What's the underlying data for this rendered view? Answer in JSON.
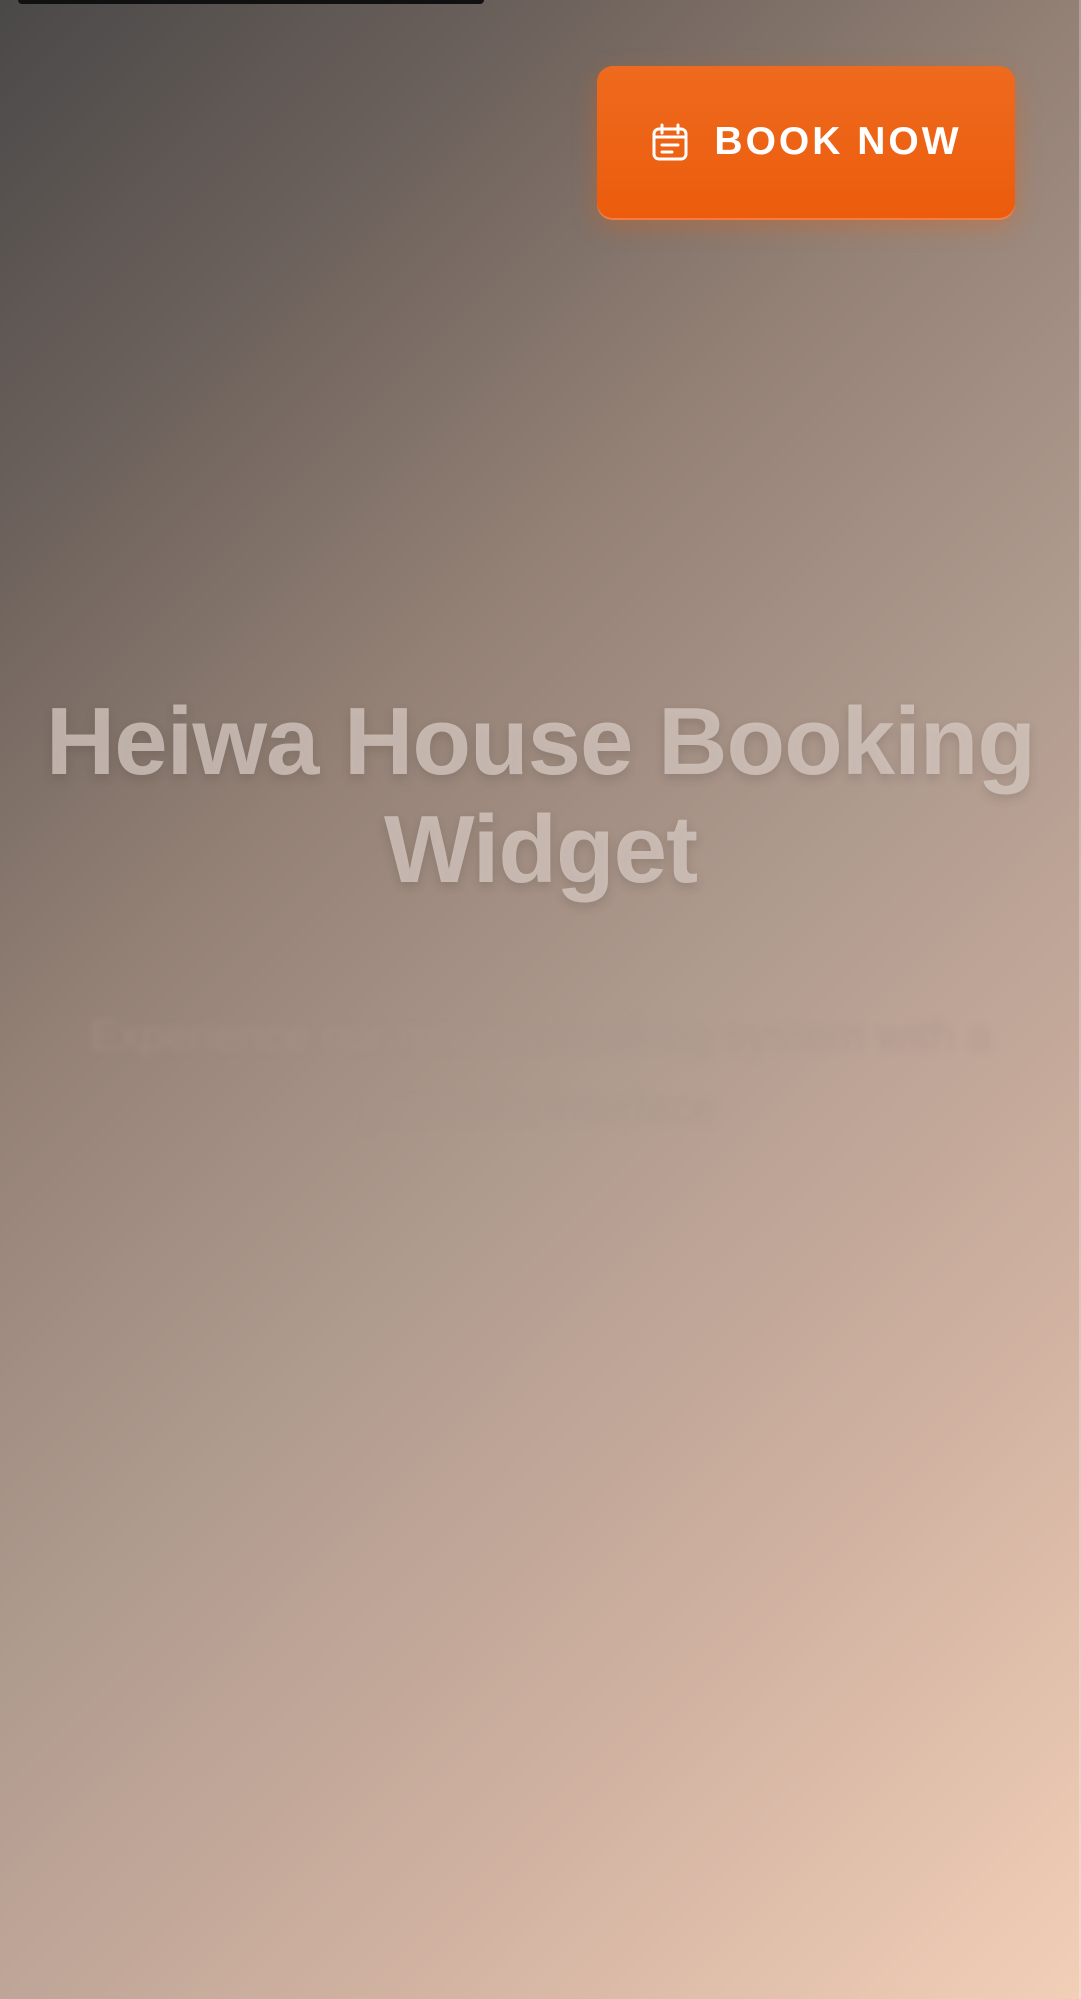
{
  "header": {
    "book_button_label": "BOOK NOW",
    "book_button_icon": "calendar-icon"
  },
  "hero": {
    "title": "Heiwa House Booking Widget",
    "subtitle": "Experience our modern booking system with a premium interface"
  },
  "colors": {
    "accent": "#EC5C0C",
    "title_text": "#DACDC6",
    "gradient_start": "#4A4848",
    "gradient_end": "#F2CFB7"
  }
}
